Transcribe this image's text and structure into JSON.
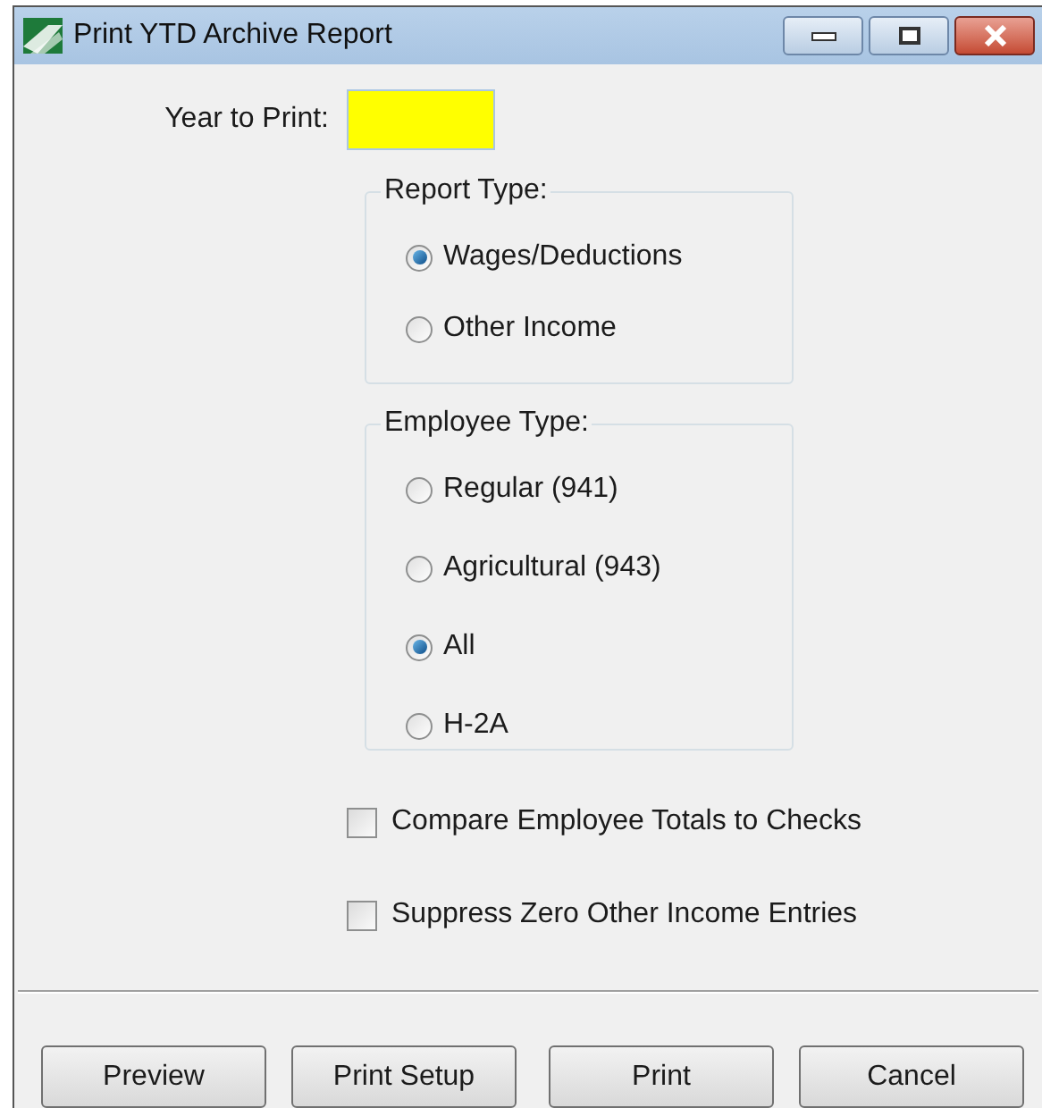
{
  "window": {
    "title": "Print YTD Archive Report"
  },
  "year_field": {
    "label": "Year to Print:"
  },
  "report_type": {
    "title": "Report Type:",
    "options": [
      {
        "label": "Wages/Deductions",
        "selected": true
      },
      {
        "label": "Other Income",
        "selected": false
      }
    ]
  },
  "employee_type": {
    "title": "Employee Type:",
    "options": [
      {
        "label": "Regular (941)",
        "selected": false
      },
      {
        "label": "Agricultural (943)",
        "selected": false
      },
      {
        "label": "All",
        "selected": true
      },
      {
        "label": "H-2A",
        "selected": false
      }
    ]
  },
  "checkboxes": [
    {
      "label": "Compare Employee Totals to Checks",
      "checked": false
    },
    {
      "label": "Suppress Zero Other Income Entries",
      "checked": false
    }
  ],
  "buttons": [
    "Preview",
    "Print Setup",
    "Print",
    "Cancel"
  ]
}
